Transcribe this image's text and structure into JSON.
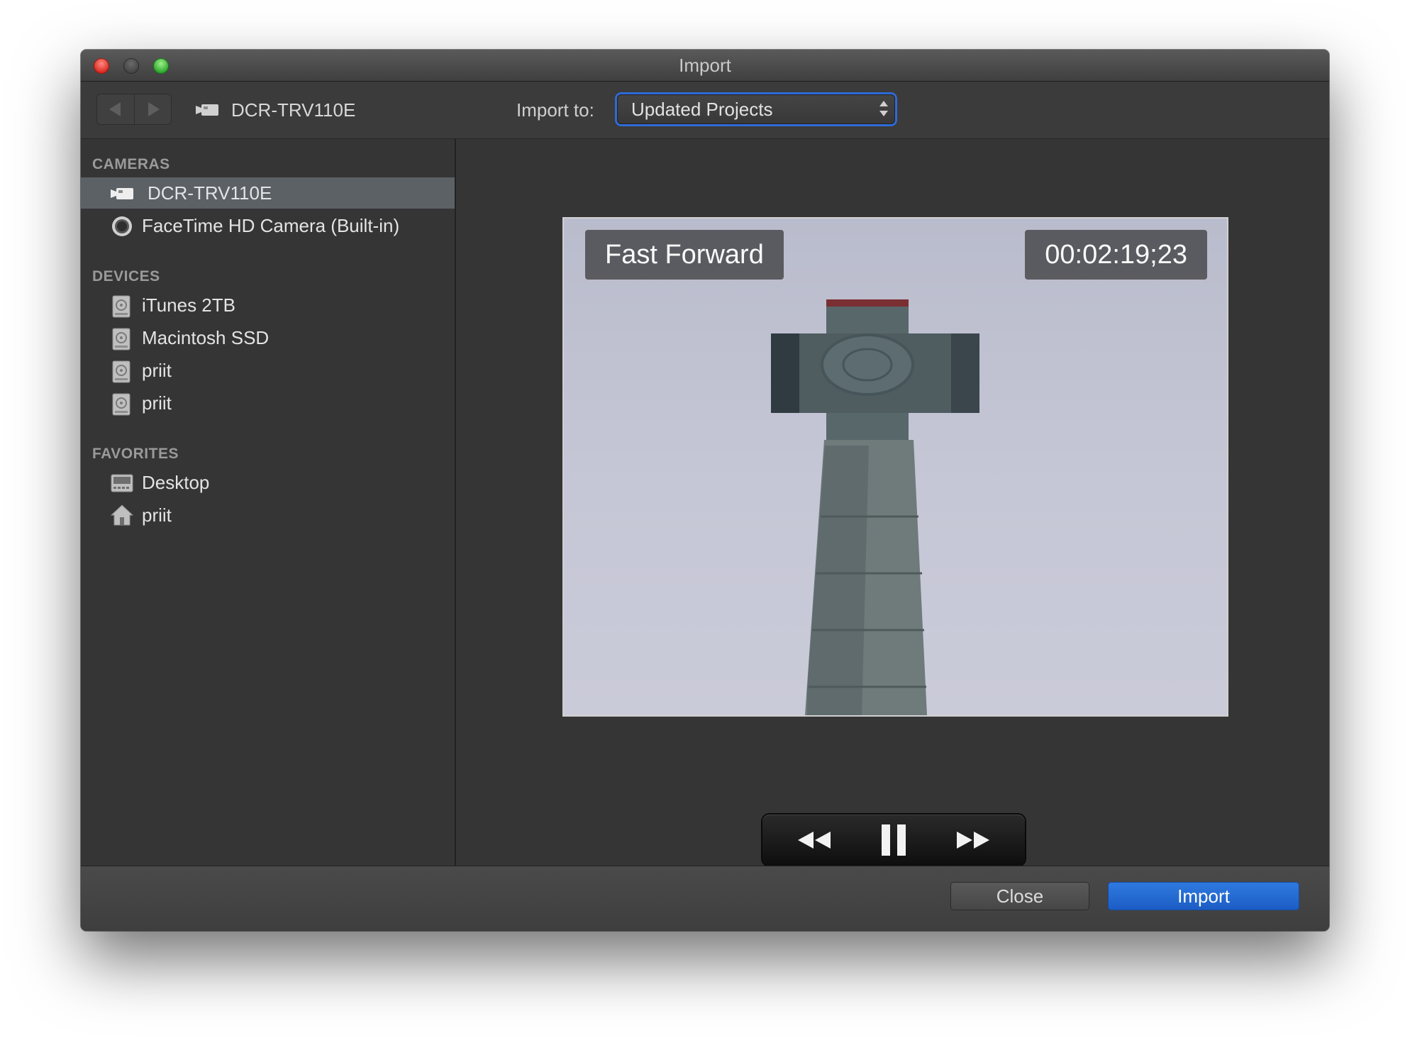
{
  "window": {
    "title": "Import"
  },
  "toolbar": {
    "device_label": "DCR-TRV110E",
    "import_to_label": "Import to:",
    "import_to_value": "Updated Projects"
  },
  "sidebar": {
    "sections": [
      {
        "title": "CAMERAS",
        "items": [
          {
            "label": "DCR-TRV110E",
            "icon": "camcorder-icon",
            "selected": true
          },
          {
            "label": "FaceTime HD Camera (Built-in)",
            "icon": "webcam-icon",
            "selected": false
          }
        ]
      },
      {
        "title": "DEVICES",
        "items": [
          {
            "label": "iTunes 2TB",
            "icon": "hard-drive-icon"
          },
          {
            "label": "Macintosh SSD",
            "icon": "hard-drive-icon"
          },
          {
            "label": "priit",
            "icon": "hard-drive-icon"
          },
          {
            "label": "priit",
            "icon": "hard-drive-icon"
          }
        ]
      },
      {
        "title": "FAVORITES",
        "items": [
          {
            "label": "Desktop",
            "icon": "desktop-icon"
          },
          {
            "label": "priit",
            "icon": "home-icon"
          }
        ]
      }
    ]
  },
  "preview": {
    "mode": "Fast Forward",
    "timecode": "00:02:19;23"
  },
  "playback": {
    "controls": [
      "rewind-icon",
      "pause-icon",
      "fast-forward-icon"
    ]
  },
  "footer": {
    "close_label": "Close",
    "import_label": "Import"
  },
  "colors": {
    "accent": "#2f6ad8",
    "selection": "#5c6166",
    "background": "#353535"
  }
}
